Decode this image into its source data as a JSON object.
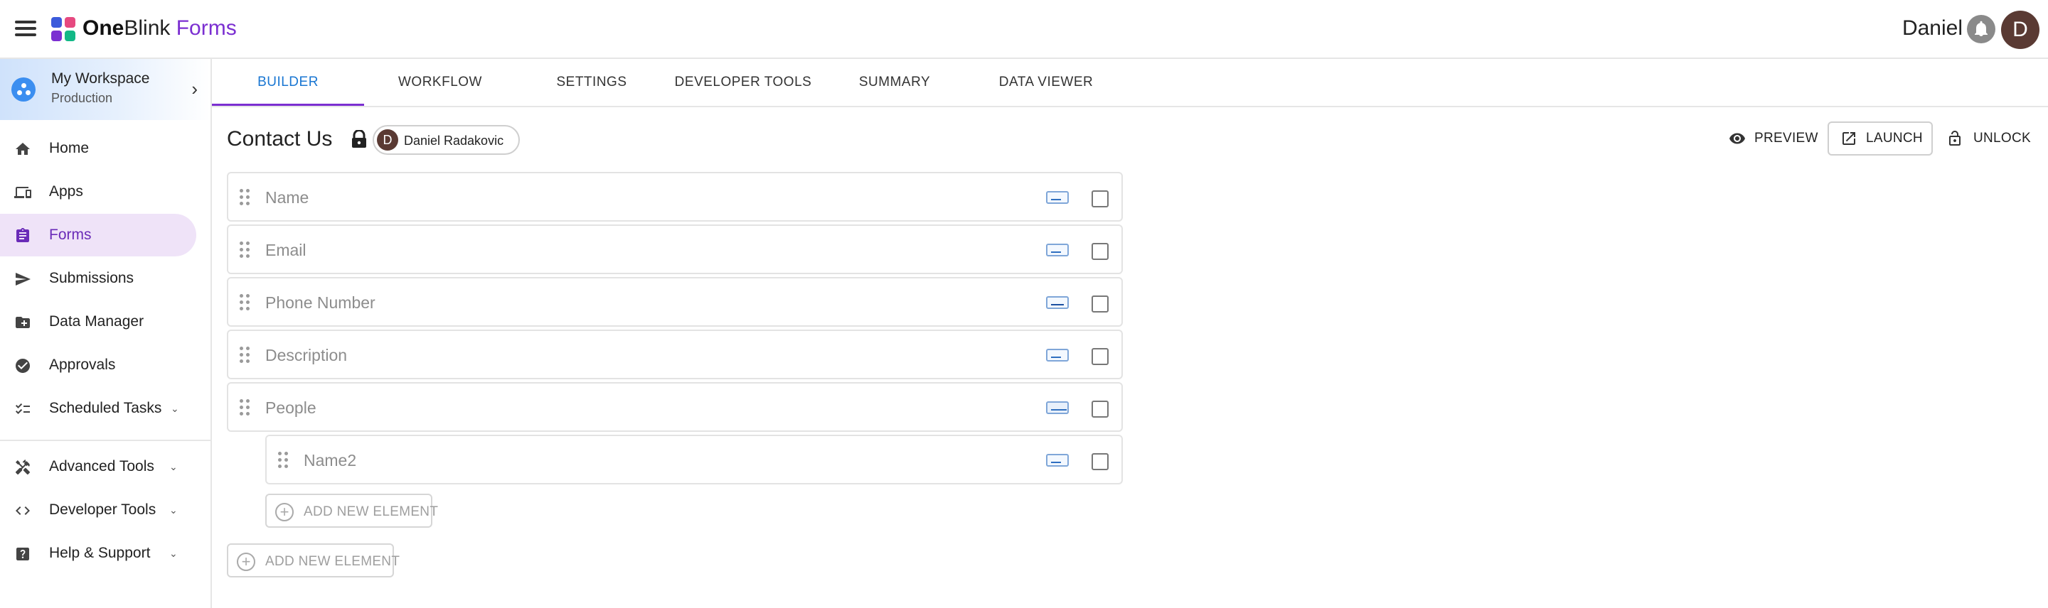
{
  "app": {
    "brand_bold": "One",
    "brand_mid": "Blink",
    "brand_product": "Forms",
    "user_name": "Daniel",
    "user_initial": "D",
    "logo_colors": [
      "#3b5bdb",
      "#e64980",
      "#7b2fd1",
      "#12b886"
    ],
    "accent": "#7b2fd1",
    "link_color": "#1976d2"
  },
  "sidebar": {
    "workspace": {
      "name": "My Workspace",
      "environment": "Production"
    },
    "items": [
      {
        "label": "Home",
        "icon": "home-icon"
      },
      {
        "label": "Apps",
        "icon": "devices-icon"
      },
      {
        "label": "Forms",
        "icon": "form-icon",
        "active": true
      },
      {
        "label": "Submissions",
        "icon": "send-icon"
      },
      {
        "label": "Data Manager",
        "icon": "folder-icon"
      },
      {
        "label": "Approvals",
        "icon": "check-circle-icon"
      },
      {
        "label": "Scheduled Tasks",
        "icon": "checklist-icon",
        "expandable": true
      }
    ],
    "footer_items": [
      {
        "label": "Advanced Tools",
        "icon": "tools-icon",
        "expandable": true
      },
      {
        "label": "Developer Tools",
        "icon": "code-icon",
        "expandable": true
      },
      {
        "label": "Help & Support",
        "icon": "help-icon",
        "expandable": true
      }
    ]
  },
  "tabs": [
    "BUILDER",
    "WORKFLOW",
    "SETTINGS",
    "DEVELOPER TOOLS",
    "SUMMARY",
    "DATA VIEWER"
  ],
  "active_tab": "BUILDER",
  "form": {
    "title": "Contact Us",
    "locked_by": {
      "name": "Daniel Radakovic",
      "initial": "D"
    },
    "actions": {
      "preview": "PREVIEW",
      "launch": "LAUNCH",
      "unlock": "UNLOCK"
    },
    "elements": [
      {
        "label": "Name",
        "type_icon": "text-field-icon"
      },
      {
        "label": "Email",
        "type_icon": "text-field-icon"
      },
      {
        "label": "Phone Number",
        "type_icon": "phone-field-icon"
      },
      {
        "label": "Description",
        "type_icon": "textarea-field-icon"
      },
      {
        "label": "People",
        "type_icon": "repeatable-set-icon"
      }
    ],
    "nested_elements": [
      {
        "label": "Name2",
        "type_icon": "text-field-icon"
      }
    ],
    "add_nested_label": "ADD NEW ELEMENT",
    "add_label": "ADD NEW ELEMENT"
  }
}
